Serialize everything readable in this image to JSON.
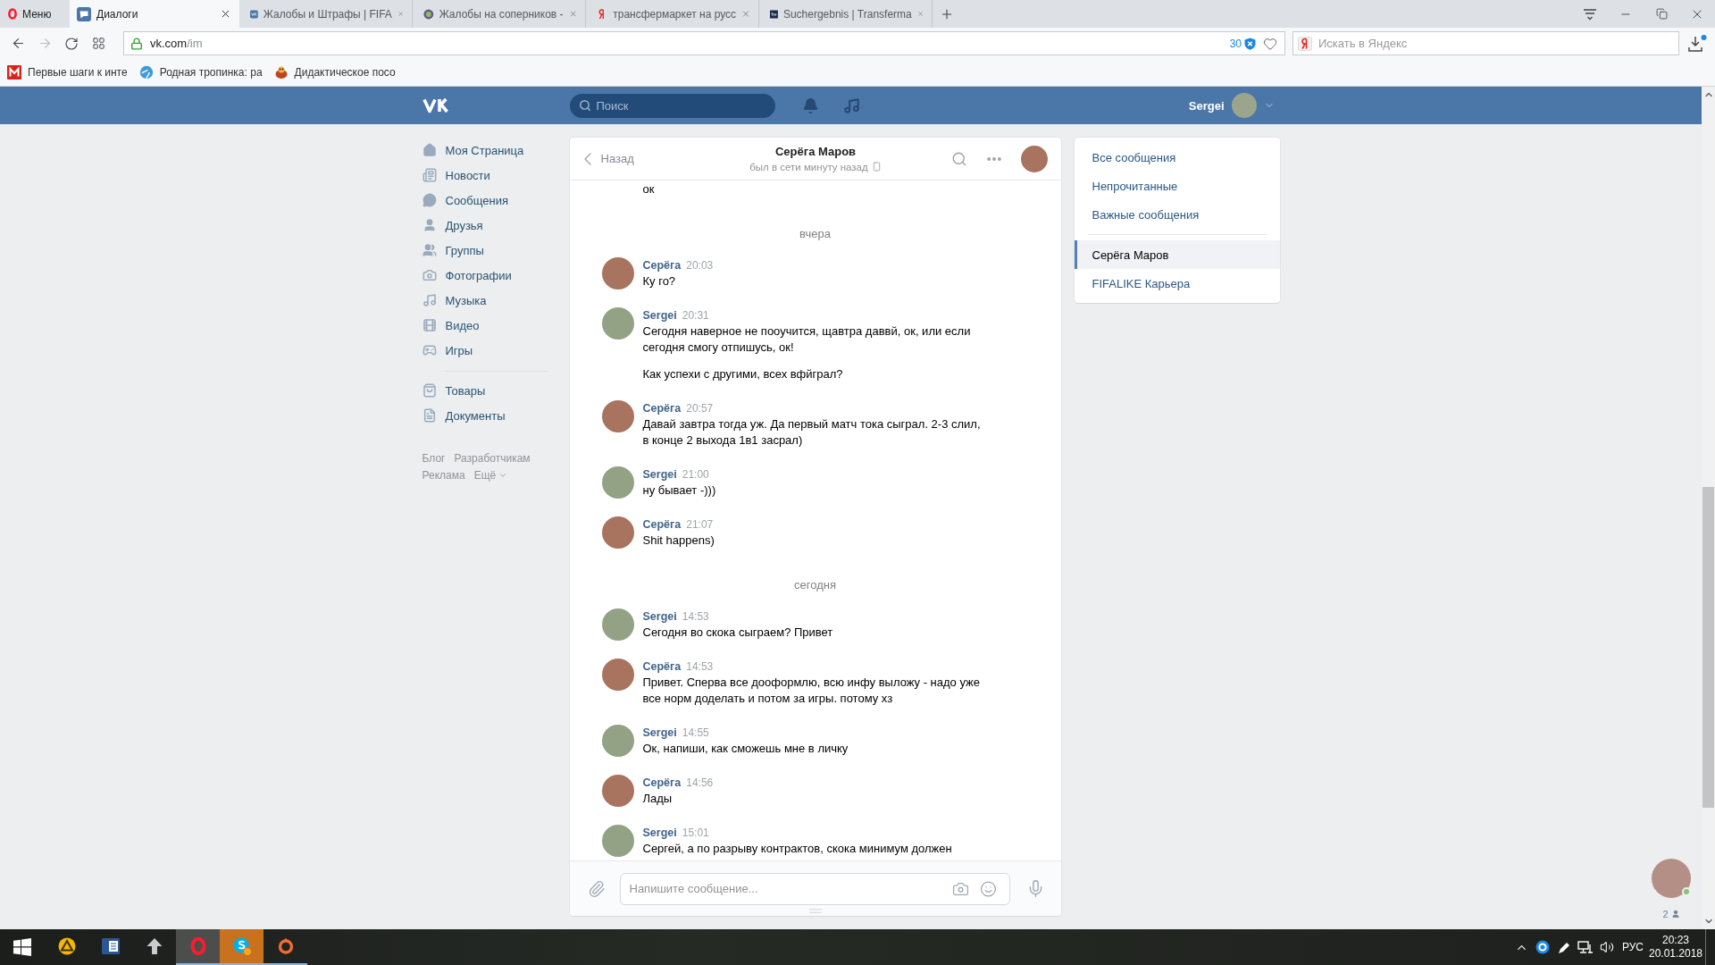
{
  "browser": {
    "menu_label": "Меню",
    "tabs": [
      {
        "title": "Диалоги",
        "kind": "chat",
        "selected": true
      },
      {
        "title": "Жалобы и Штрафы | FIFA",
        "kind": "vk",
        "selected": false
      },
      {
        "title": "Жалобы на соперников -",
        "kind": "round",
        "selected": false
      },
      {
        "title": "трансфермаркет на русс",
        "kind": "yandex",
        "selected": false
      },
      {
        "title": "Suchergebnis | Transferma",
        "kind": "tm",
        "selected": false
      }
    ],
    "navigation": {
      "back_disabled": false,
      "forward_disabled": true
    },
    "address": {
      "host": "vk.com",
      "path": "/im",
      "blocked_count": "30"
    },
    "search": {
      "placeholder": "Искать в Яндекс"
    },
    "bookmarks": [
      {
        "title": "Первые шаги к инте",
        "kind": "mail"
      },
      {
        "title": "Родная тропинка: ра",
        "kind": "globe"
      },
      {
        "title": "Дидактическое посо",
        "kind": "toy"
      }
    ]
  },
  "header": {
    "search": {
      "placeholder": "Поиск"
    },
    "user_name": "Sergei"
  },
  "sidebar": {
    "items": [
      {
        "label": "Моя Страница",
        "kind": "home"
      },
      {
        "label": "Новости",
        "kind": "news"
      },
      {
        "label": "Сообщения",
        "kind": "messages"
      },
      {
        "label": "Друзья",
        "kind": "friends"
      },
      {
        "label": "Группы",
        "kind": "groups"
      },
      {
        "label": "Фотографии",
        "kind": "photos"
      },
      {
        "label": "Музыка",
        "kind": "music"
      },
      {
        "label": "Видео",
        "kind": "video"
      },
      {
        "label": "Игры",
        "kind": "games"
      }
    ],
    "extra_items": [
      {
        "label": "Товары",
        "kind": "goods"
      },
      {
        "label": "Документы",
        "kind": "docs"
      }
    ],
    "footer_links": [
      {
        "label": "Блог",
        "dropdown": false
      },
      {
        "label": "Разработчикам",
        "dropdown": false
      },
      {
        "label": "Реклама",
        "dropdown": false
      },
      {
        "label": "Ещё",
        "dropdown": true
      }
    ]
  },
  "chat": {
    "back_label": "Назад",
    "title": "Серёга Маров",
    "status": "был в сети минуту назад",
    "messages": [
      {
        "kind": "continuation",
        "texts": [
          "ок"
        ]
      },
      {
        "kind": "date",
        "label": "вчера"
      },
      {
        "kind": "group",
        "author": "Серёга",
        "time": "20:03",
        "color": "#a8735f",
        "texts": [
          "Ку го?"
        ]
      },
      {
        "kind": "group",
        "author": "Sergei",
        "time": "20:31",
        "color": "#93a184",
        "texts": [
          "Сегодня наверное не пооучится, щавтра даввй, ок, или если\nсегодня смогу отпишусь, ок!",
          "Как успехи с другими, всех вфйграл?"
        ]
      },
      {
        "kind": "group",
        "author": "Серёга",
        "time": "20:57",
        "color": "#a8735f",
        "texts": [
          "Давай завтра тогда уж. Да первый матч тока сыграл. 2-3 слил,\nв конце 2 выхода 1в1 засрал)"
        ]
      },
      {
        "kind": "group",
        "author": "Sergei",
        "time": "21:00",
        "color": "#93a184",
        "texts": [
          "ну бывает -)))"
        ]
      },
      {
        "kind": "group",
        "author": "Серёга",
        "time": "21:07",
        "color": "#a8735f",
        "texts": [
          "Shit happens)"
        ]
      },
      {
        "kind": "date",
        "label": "сегодня"
      },
      {
        "kind": "group",
        "author": "Sergei",
        "time": "14:53",
        "color": "#93a184",
        "texts": [
          "Сегодня во скока сыграем? Привет"
        ]
      },
      {
        "kind": "group",
        "author": "Серёга",
        "time": "14:53",
        "color": "#a8735f",
        "texts": [
          "Привет. Сперва все дооформлю, всю инфу выложу - надо уже\nвсе норм доделать и потом за игры. потому хз"
        ]
      },
      {
        "kind": "group",
        "author": "Sergei",
        "time": "14:55",
        "color": "#93a184",
        "texts": [
          "Ок, напиши, как сможешь мне в личку"
        ]
      },
      {
        "kind": "group",
        "author": "Серёга",
        "time": "14:56",
        "color": "#a8735f",
        "texts": [
          "Лады"
        ]
      },
      {
        "kind": "group",
        "author": "Sergei",
        "time": "15:01",
        "color": "#93a184",
        "texts": [
          "Сергей, а по разрыву контрактов, скока минимум должен"
        ]
      }
    ],
    "input": {
      "placeholder": "Напишите сообщение..."
    }
  },
  "dialogs_menu": {
    "filters": [
      {
        "label": "Все сообщения",
        "selected": false
      },
      {
        "label": "Непрочитанные",
        "selected": false
      },
      {
        "label": "Важные сообщения",
        "selected": false
      }
    ],
    "conversations": [
      {
        "label": "Серёга Маров",
        "selected": true
      },
      {
        "label": "FIFALIKE Карьера",
        "selected": false
      }
    ]
  },
  "widget": {
    "online": true,
    "count": "2"
  },
  "taskbar": {
    "apps": [
      {
        "kind": "aimp",
        "running": false,
        "focused": false,
        "flashing": false
      },
      {
        "kind": "word",
        "running": false,
        "focused": false,
        "flashing": false
      },
      {
        "kind": "upload",
        "running": false,
        "focused": false,
        "flashing": false
      },
      {
        "kind": "opera",
        "running": true,
        "focused": true,
        "flashing": false
      },
      {
        "kind": "skype",
        "running": true,
        "focused": false,
        "flashing": true
      },
      {
        "kind": "origin",
        "running": true,
        "focused": false,
        "flashing": false
      }
    ],
    "language": "РУС",
    "time": "20:23",
    "date": "20.01.2018"
  }
}
